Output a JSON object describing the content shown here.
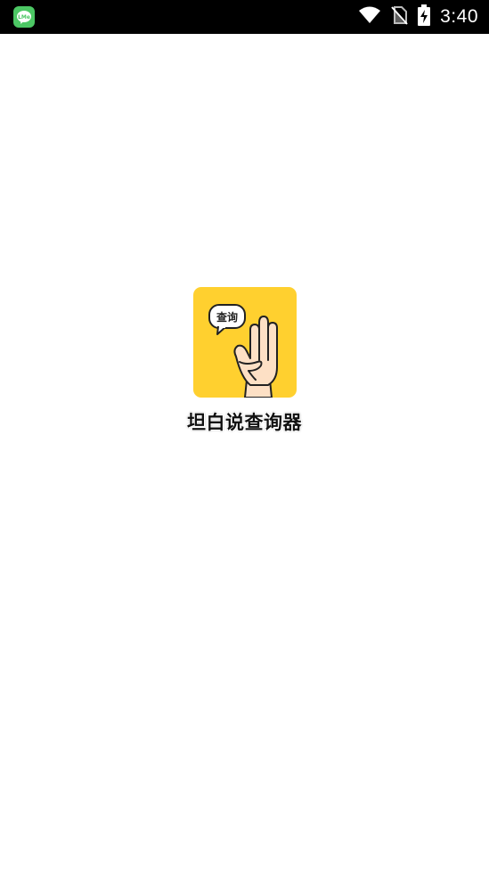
{
  "status_bar": {
    "time": "3:40",
    "notification_icon": "line-me-icon",
    "icons": [
      "wifi-icon",
      "no-sim-icon",
      "battery-charging-icon"
    ]
  },
  "splash": {
    "app_name": "坦白说查询器",
    "icon_bubble_text": "查询",
    "icon_background_color": "#ffd02f"
  }
}
